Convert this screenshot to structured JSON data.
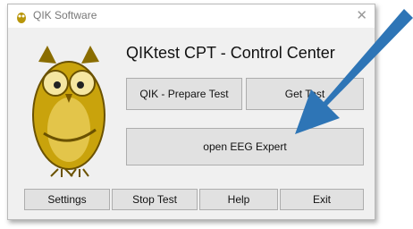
{
  "window": {
    "title": "QIK Software"
  },
  "main": {
    "headline": "QIKtest CPT - Control Center",
    "buttons": {
      "prepare": "QIK - Prepare Test",
      "get_test": "Get Test",
      "open_eeg": "open EEG Expert"
    }
  },
  "footer": {
    "settings": "Settings",
    "stop": "Stop Test",
    "help": "Help",
    "exit": "Exit"
  },
  "colors": {
    "arrow": "#2e75b6",
    "owl": "#b8960a"
  },
  "icons": {
    "close": "close-icon",
    "app": "owl-app-icon",
    "pointer": "arrow-annotation"
  }
}
